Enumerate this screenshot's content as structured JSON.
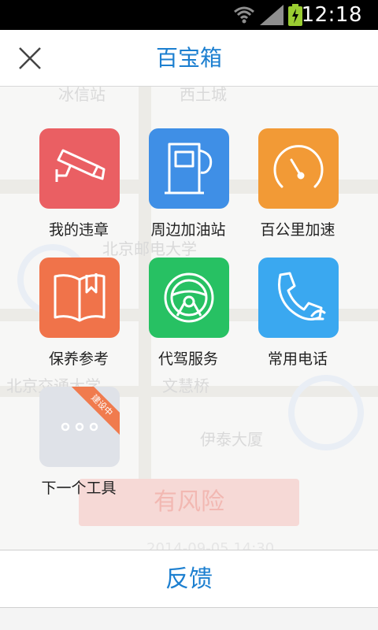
{
  "status_bar": {
    "time": "12:18"
  },
  "header": {
    "title": "百宝箱"
  },
  "tools": [
    {
      "label": "我的违章",
      "color": "#ea5f63",
      "icon": "camera-icon"
    },
    {
      "label": "周边加油站",
      "color": "#3f8fe6",
      "icon": "gas-pump-icon"
    },
    {
      "label": "百公里加速",
      "color": "#f29a36",
      "icon": "speedometer-icon"
    },
    {
      "label": "保养参考",
      "color": "#f0734a",
      "icon": "book-icon"
    },
    {
      "label": "代驾服务",
      "color": "#27c163",
      "icon": "steering-wheel-icon"
    },
    {
      "label": "常用电话",
      "color": "#3aa8f0",
      "icon": "phone-icon"
    },
    {
      "label": "下一个工具",
      "color": "#dfe2e8",
      "icon": "more-icon",
      "badge": "建设中"
    }
  ],
  "background": {
    "labels": [
      "冰信站",
      "西土城",
      "北京邮电大学",
      "北京交通大学",
      "文慧桥",
      "伊泰大厦",
      "有风险",
      "2014-09-05 14:30"
    ]
  },
  "feedback": {
    "label": "反馈"
  }
}
